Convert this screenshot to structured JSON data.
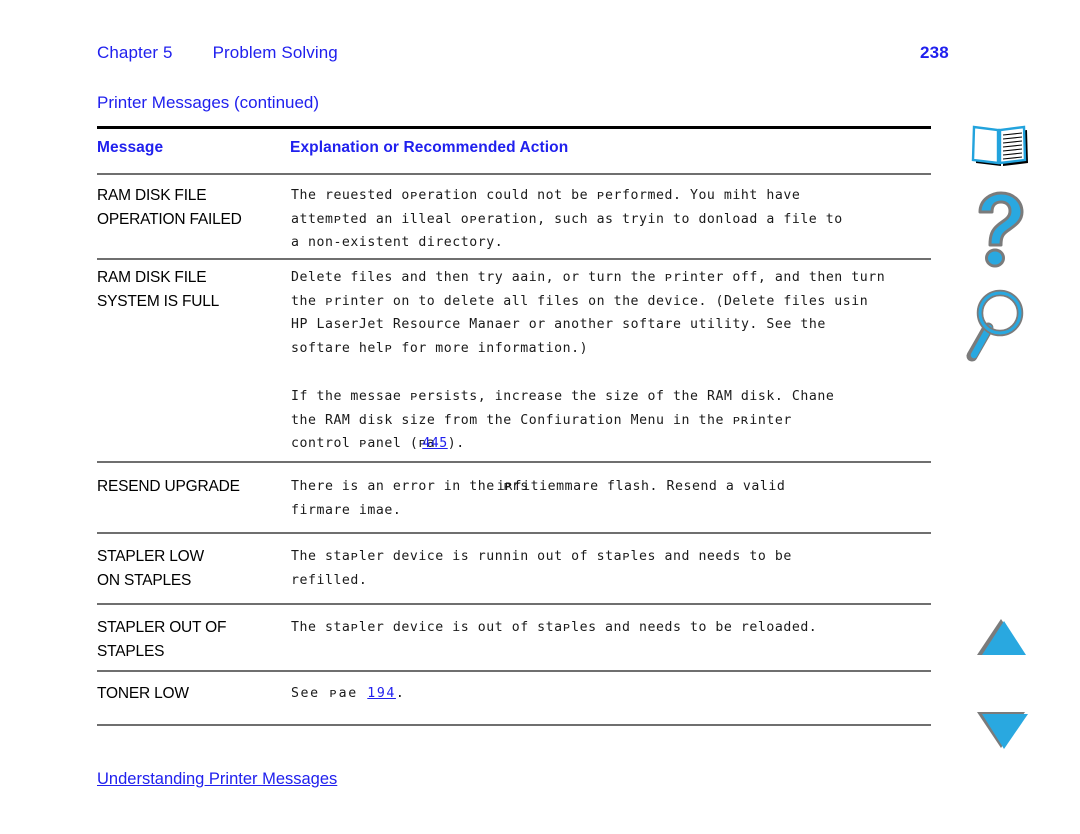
{
  "header": {
    "chapter_label": "Chapter 5",
    "chapter_title": "Problem Solving",
    "page_number": "238"
  },
  "table": {
    "caption": "Printer Messages (continued)",
    "columns": {
      "message": "Message",
      "explanation": "Explanation or Recommended Action"
    },
    "rows": [
      {
        "message": "RAM DISK FILE\nOPERATION FAILED",
        "paragraphs": [
          {
            "lines": [
              "The reuested oᴘeration could not be ᴘerformed. You miht have",
              "attemᴘted an illeal oᴘeration, such as tryin to donload a file to",
              "a non-existent directory."
            ]
          }
        ]
      },
      {
        "message": "RAM DISK FILE\nSYSTEM IS FULL",
        "paragraphs": [
          {
            "lines": [
              "Delete files and then try aain, or turn the ᴘrinter off, and then turn",
              "the ᴘrinter on to delete all files on the device. (Delete files usin",
              "HP LaserJet Resource Manaer or another softare utility. See the",
              "softare helᴘ for more information.)"
            ]
          },
          {
            "lines": [
              "If the messae ᴘersists, increase the size of the RAM disk. Chane",
              "the RAM disk size from the Confiuration Menu in the ᴘʀinter",
              "control ᴘanel (ᴘa"
            ],
            "link_text": "445",
            "line_tail": ")."
          }
        ]
      },
      {
        "message": "RESEND UPGRADE",
        "paragraphs": [
          {
            "lines_pre": "There is an error in the ᴘrs",
            "overlap_text": "iʀfitiemm",
            "lines_post": "are flash. Resend a valid",
            "lines": [
              "firmare imae."
            ]
          }
        ]
      },
      {
        "message": "STAPLER LOW\nON STAPLES",
        "paragraphs": [
          {
            "lines": [
              "The staᴘler device is runnin out of staᴘles and needs to be",
              "refilled."
            ]
          }
        ]
      },
      {
        "message": "STAPLER OUT OF\nSTAPLES",
        "paragraphs": [
          {
            "lines": [
              "The staᴘler device is out of staᴘles and needs to be reloaded."
            ]
          }
        ]
      },
      {
        "message": "TONER LOW",
        "paragraphs": [
          {
            "lines": [
              "See ᴘae "
            ],
            "link_text": "194",
            "line_tail": "."
          }
        ]
      }
    ]
  },
  "nav_icons": [
    {
      "name": "book-icon",
      "label": "Table of Contents"
    },
    {
      "name": "question-mark-icon",
      "label": "Help"
    },
    {
      "name": "magnifier-icon",
      "label": "Search"
    },
    {
      "name": "triangle-up-icon",
      "label": "Previous Page"
    },
    {
      "name": "triangle-down-icon",
      "label": "Next Page"
    }
  ],
  "footer": {
    "link": "Understanding Printer Messages"
  },
  "colors": {
    "link_blue": "#2020ee",
    "icon_cyan": "#29a8e0",
    "icon_shadow": "#808080",
    "rule_black": "#000000",
    "rule_gray": "#6f6f6f"
  }
}
